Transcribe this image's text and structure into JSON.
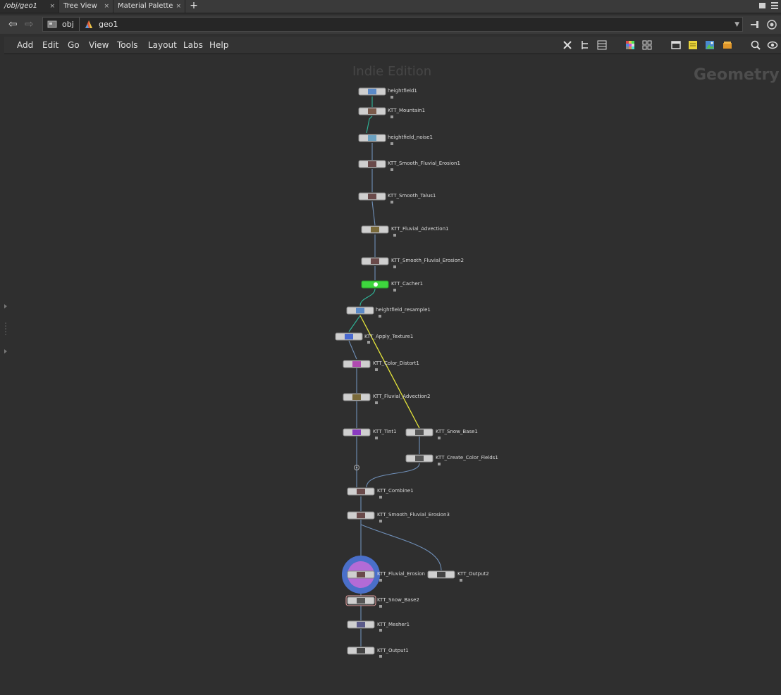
{
  "tabs": [
    {
      "label": "/obj/geo1",
      "close": "×"
    },
    {
      "label": "Tree View",
      "close": "×"
    },
    {
      "label": "Material Palette",
      "close": "×"
    }
  ],
  "tab_add": "+",
  "path": {
    "back": "⇦",
    "forward": "⇨",
    "crumbs": [
      "obj",
      "geo1"
    ],
    "dropdown": "▼"
  },
  "menu": [
    "Add",
    "Edit",
    "Go",
    "View",
    "Tools",
    "Layout",
    "Labs",
    "Help"
  ],
  "watermark": "Indie Edition",
  "context_label": "Geometry",
  "nodes": [
    {
      "label": "heightfield1"
    },
    {
      "label": "KTT_Mountain1"
    },
    {
      "label": "heightfield_noise1"
    },
    {
      "label": "KTT_Smooth_Fluvial_Erosion1"
    },
    {
      "label": "KTT_Smooth_Talus1"
    },
    {
      "label": "KTT_Fluvial_Advection1"
    },
    {
      "label": "KTT_Smooth_Fluvial_Erosion2"
    },
    {
      "label": "KTT_Cacher1"
    },
    {
      "label": "heightfield_resample1"
    },
    {
      "label": "KTT_Apply_Texture1"
    },
    {
      "label": "KTT_Color_Distort1"
    },
    {
      "label": "KTT_Fluvial_Advection2"
    },
    {
      "label": "KTT_Tint1"
    },
    {
      "label": "KTT_Snow_Base1"
    },
    {
      "label": "KTT_Create_Color_Fields1"
    },
    {
      "label": "KTT_Combine1"
    },
    {
      "label": "KTT_Smooth_Fluvial_Erosion3"
    },
    {
      "label": "KTT_Fluvial_Erosion"
    },
    {
      "label": "KTT_Output2"
    },
    {
      "label": "KTT_Snow_Base2"
    },
    {
      "label": "KTT_Mesher1"
    },
    {
      "label": "KTT_Output1"
    }
  ],
  "colors": {
    "wire": "#6f8fb8",
    "wire_teal": "#2fb89a",
    "wire_selected": "#e8e83a",
    "node_body": "#cfcfcf",
    "node_green": "#3ed63e",
    "display_ring": "#4a6fc9",
    "render_ring": "#b36bd6"
  }
}
